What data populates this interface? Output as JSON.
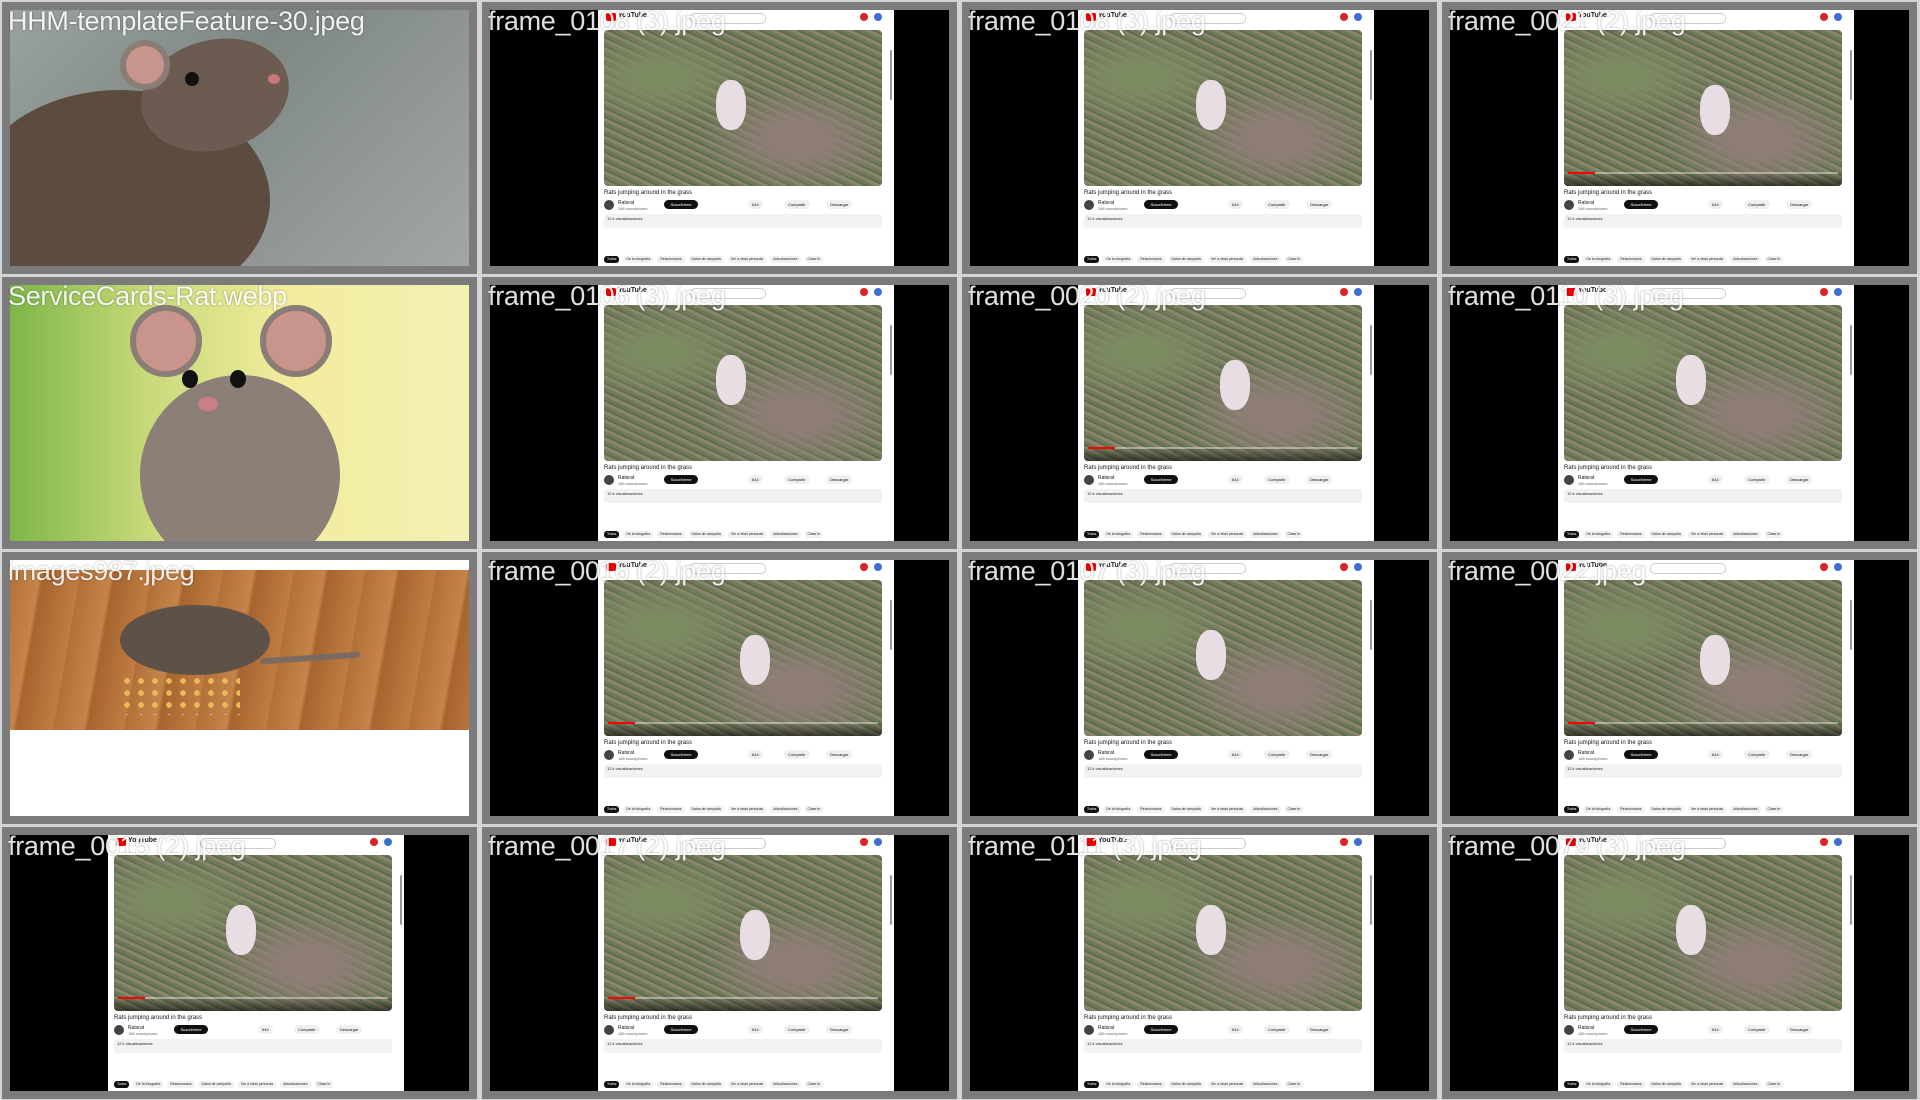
{
  "tiles": [
    {
      "label": "HHM-templateFeature-30.jpeg",
      "kind": "photo1"
    },
    {
      "label": "frame_0108 (3).jpeg",
      "kind": "video",
      "variant": "a"
    },
    {
      "label": "frame_0108 (3).jpeg",
      "kind": "video",
      "variant": "a"
    },
    {
      "label": "frame_0021 (2).jpeg",
      "kind": "video",
      "variant": "b"
    },
    {
      "label": "ServiceCards-Rat.webp",
      "kind": "photo2"
    },
    {
      "label": "frame_0106 (3).jpeg",
      "kind": "video",
      "variant": "a"
    },
    {
      "label": "frame_0020 (2).jpeg",
      "kind": "video",
      "variant": "b"
    },
    {
      "label": "frame_0110 (3).jpeg",
      "kind": "video",
      "variant": "a"
    },
    {
      "label": "images987.jpeg",
      "kind": "photo3"
    },
    {
      "label": "frame_0016 (2).jpeg",
      "kind": "video",
      "variant": "b"
    },
    {
      "label": "frame_0107 (3).jpeg",
      "kind": "video",
      "variant": "a"
    },
    {
      "label": "frame_0022.jpeg",
      "kind": "video",
      "variant": "b"
    },
    {
      "label": "frame_0015 (2).jpeg",
      "kind": "video",
      "variant": "c"
    },
    {
      "label": "frame_0017 (2).jpeg",
      "kind": "video",
      "variant": "b"
    },
    {
      "label": "frame_0111 (3).jpeg",
      "kind": "video",
      "variant": "a"
    },
    {
      "label": "frame_0079 (3).jpeg",
      "kind": "video",
      "variant": "a"
    }
  ],
  "video_page": {
    "logo": "YouTube",
    "title": "Rats jumping around in the grass",
    "channel": "Ratsrat",
    "subs": "186 suscriptores",
    "subscribe": "Suscribirme",
    "likes": "644",
    "share": "Compartir",
    "download": "Descargar",
    "views": "12 k visualizaciones",
    "chips": [
      "Todos",
      "De la fotografía",
      "Relacionados",
      "Datos de campaña",
      "Ver a otras personas",
      "Actualizaciones",
      "Clase le"
    ]
  }
}
